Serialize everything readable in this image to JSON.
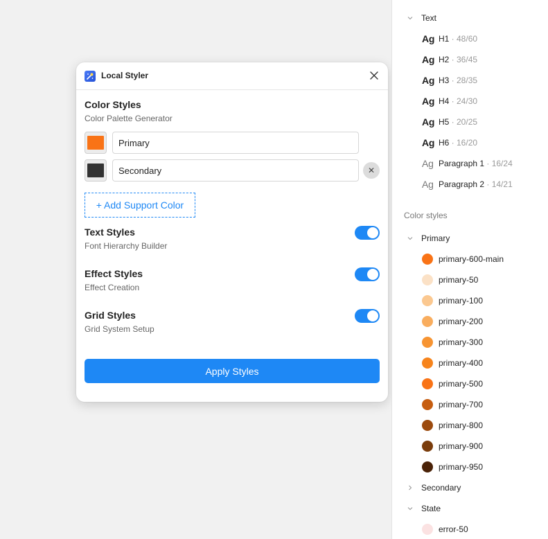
{
  "dialog": {
    "title": "Local Styler",
    "color_styles": {
      "title": "Color Styles",
      "subtitle": "Color Palette Generator",
      "colors": [
        {
          "value": "Primary",
          "swatch": "#f97316"
        },
        {
          "value": "Secondary",
          "swatch": "#333333"
        }
      ],
      "remove_label": "✕",
      "add_label": "+ Add Support Color"
    },
    "text_styles": {
      "title": "Text Styles",
      "subtitle": "Font Hierarchy Builder",
      "enabled": true
    },
    "effect_styles": {
      "title": "Effect Styles",
      "subtitle": "Effect Creation",
      "enabled": true
    },
    "grid_styles": {
      "title": "Grid Styles",
      "subtitle": "Grid System Setup",
      "enabled": true
    },
    "apply_label": "Apply Styles",
    "accent": "#1e88f5"
  },
  "styles_panel": {
    "text_group": "Text",
    "text_styles": [
      {
        "sample": "Ag",
        "name": "H1",
        "meta": " · 48/60",
        "bold": true
      },
      {
        "sample": "Ag",
        "name": "H2",
        "meta": " · 36/45",
        "bold": true
      },
      {
        "sample": "Ag",
        "name": "H3",
        "meta": " · 28/35",
        "bold": true
      },
      {
        "sample": "Ag",
        "name": "H4",
        "meta": " · 24/30",
        "bold": true
      },
      {
        "sample": "Ag",
        "name": "H5",
        "meta": " · 20/25",
        "bold": true
      },
      {
        "sample": "Ag",
        "name": "H6",
        "meta": " · 16/20",
        "bold": true
      },
      {
        "sample": "Ag",
        "name": "Paragraph 1",
        "meta": " · 16/24",
        "bold": false
      },
      {
        "sample": "Ag",
        "name": "Paragraph 2",
        "meta": " · 14/21",
        "bold": false
      }
    ],
    "color_section": "Color styles",
    "primary_group": "Primary",
    "primary_colors": [
      {
        "name": "primary-600-main",
        "color": "#f97316"
      },
      {
        "name": "primary-50",
        "color": "#fbe1c6"
      },
      {
        "name": "primary-100",
        "color": "#fbc890"
      },
      {
        "name": "primary-200",
        "color": "#f9ad5e"
      },
      {
        "name": "primary-300",
        "color": "#f79432"
      },
      {
        "name": "primary-400",
        "color": "#f7841c"
      },
      {
        "name": "primary-500",
        "color": "#f97316"
      },
      {
        "name": "primary-700",
        "color": "#c65d10"
      },
      {
        "name": "primary-800",
        "color": "#9c4b0e"
      },
      {
        "name": "primary-900",
        "color": "#7a3c0b"
      },
      {
        "name": "primary-950",
        "color": "#4a2208"
      }
    ],
    "secondary_group": "Secondary",
    "state_group": "State",
    "state_colors": [
      {
        "name": "error-50",
        "color": "#fbe2e2"
      }
    ]
  }
}
